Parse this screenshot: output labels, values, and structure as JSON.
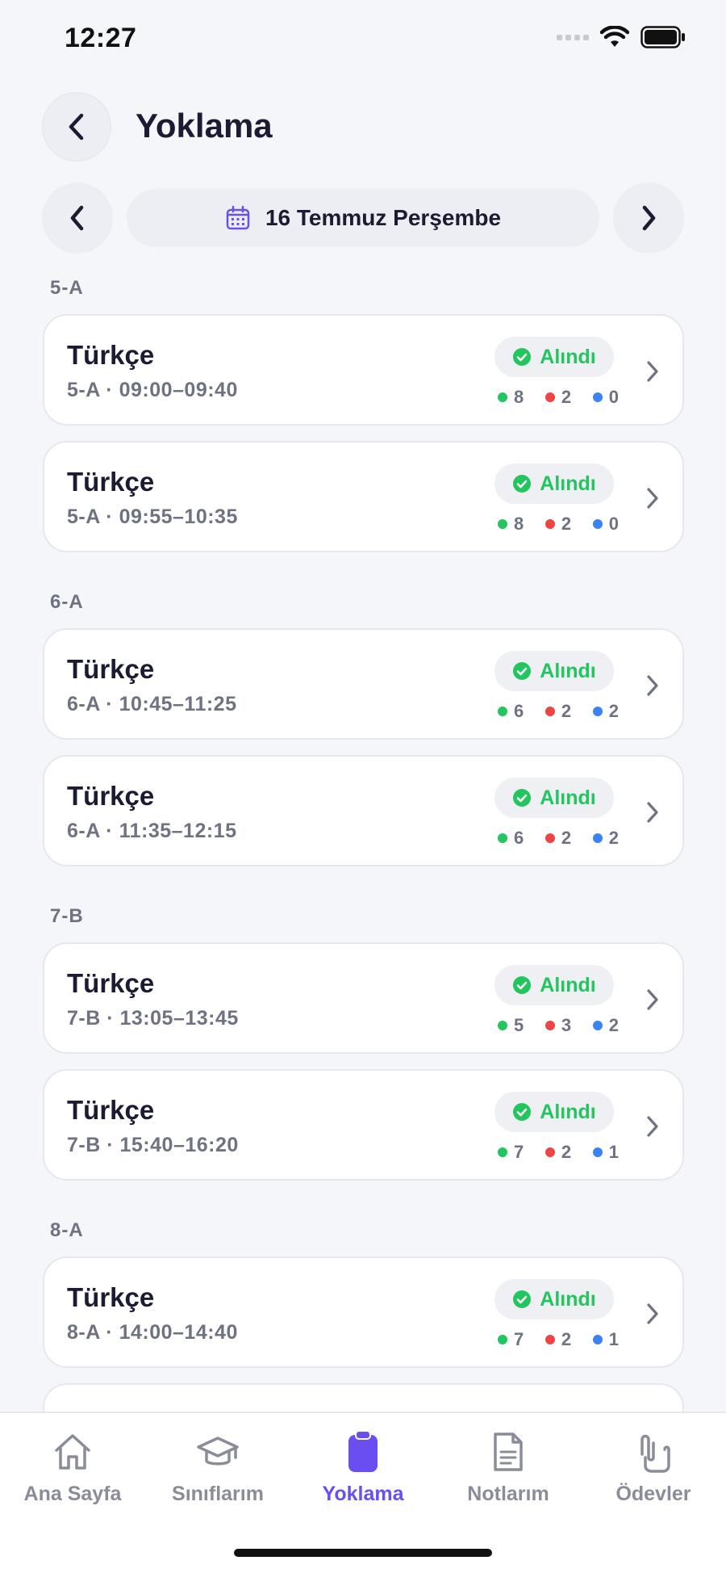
{
  "status_bar": {
    "time": "12:27"
  },
  "header": {
    "title": "Yoklama"
  },
  "date_nav": {
    "date": "16 Temmuz Perşembe"
  },
  "sections": [
    {
      "label": "5-A",
      "lessons": [
        {
          "subject": "Türkçe",
          "detail": "5-A · 09:00–09:40",
          "status": "Alındı",
          "present": "8",
          "absent": "2",
          "other": "0"
        },
        {
          "subject": "Türkçe",
          "detail": "5-A · 09:55–10:35",
          "status": "Alındı",
          "present": "8",
          "absent": "2",
          "other": "0"
        }
      ]
    },
    {
      "label": "6-A",
      "lessons": [
        {
          "subject": "Türkçe",
          "detail": "6-A · 10:45–11:25",
          "status": "Alındı",
          "present": "6",
          "absent": "2",
          "other": "2"
        },
        {
          "subject": "Türkçe",
          "detail": "6-A · 11:35–12:15",
          "status": "Alındı",
          "present": "6",
          "absent": "2",
          "other": "2"
        }
      ]
    },
    {
      "label": "7-B",
      "lessons": [
        {
          "subject": "Türkçe",
          "detail": "7-B · 13:05–13:45",
          "status": "Alındı",
          "present": "5",
          "absent": "3",
          "other": "2"
        },
        {
          "subject": "Türkçe",
          "detail": "7-B · 15:40–16:20",
          "status": "Alındı",
          "present": "7",
          "absent": "2",
          "other": "1"
        }
      ]
    },
    {
      "label": "8-A",
      "lessons": [
        {
          "subject": "Türkçe",
          "detail": "8-A · 14:00–14:40",
          "status": "Alındı",
          "present": "7",
          "absent": "2",
          "other": "1"
        }
      ]
    }
  ],
  "colors": {
    "accent": "#6b4ef0",
    "present": "#22c55e",
    "absent": "#ef4444",
    "other": "#3b82f6"
  },
  "tabs": [
    {
      "label": "Ana Sayfa",
      "icon": "home-icon"
    },
    {
      "label": "Sınıflarım",
      "icon": "graduation-cap-icon"
    },
    {
      "label": "Yoklama",
      "icon": "clipboard-icon",
      "active": true
    },
    {
      "label": "Notlarım",
      "icon": "document-icon"
    },
    {
      "label": "Ödevler",
      "icon": "paperclip-icon"
    }
  ]
}
